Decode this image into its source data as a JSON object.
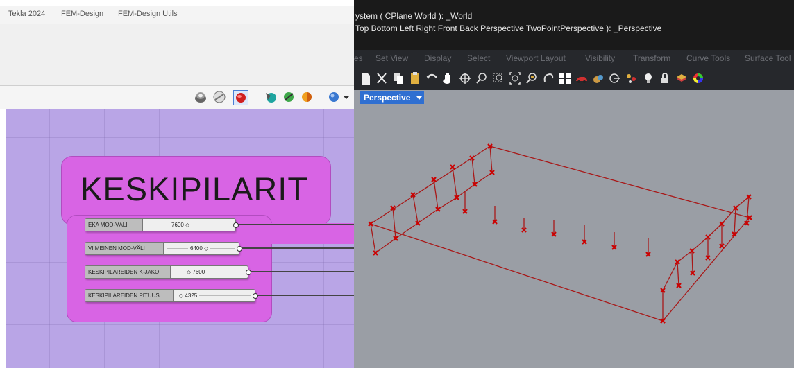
{
  "grasshopper": {
    "menu": [
      "Tekla 2024",
      "FEM-Design",
      "FEM-Design Utils"
    ],
    "group_title": "KESKIPILARIT",
    "sliders": [
      {
        "label": "EKA MOD-VÄLI",
        "value": "7600 ◇"
      },
      {
        "label": "VIIMEINEN MOD-VÄLI",
        "value": "6400 ◇"
      },
      {
        "label": "KESKIPILAREIDEN K-JAKO",
        "value": "◇ 7600"
      },
      {
        "label": "KESKIPILAREIDEN PITUUS",
        "value": "◇ 4325"
      }
    ],
    "colors": {
      "canvas": "#b9a5e6",
      "group": "#d864e4"
    }
  },
  "rhino": {
    "command_history": [
      "ystem ( CPlane  World ): _World",
      "Top  Bottom  Left  Right  Front  Back  Perspective  TwoPointPerspective ): _Perspective"
    ],
    "tabs": [
      "es",
      "Set View",
      "Display",
      "Select",
      "Viewport Layout",
      "Visibility",
      "Transform",
      "Curve Tools",
      "Surface Tool"
    ],
    "viewport": {
      "name": "Perspective"
    },
    "colors": {
      "viewport_bg": "#9a9ea5",
      "geometry": "#b01818",
      "accent": "#2f6fd1"
    }
  }
}
